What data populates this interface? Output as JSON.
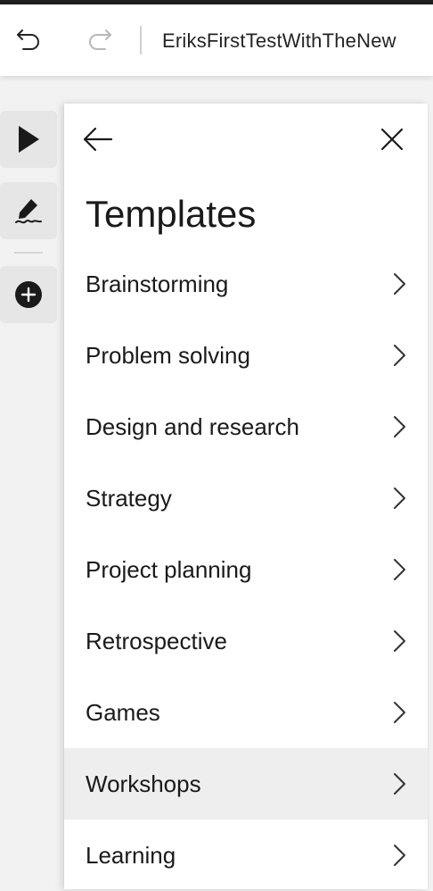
{
  "titlebar": {
    "document_title": "EriksFirstTestWithTheNew",
    "undo_icon": "undo-icon",
    "redo_icon": "redo-icon"
  },
  "toolbar": {
    "tools": [
      "select-pointer-icon",
      "ink-pen-icon",
      "add-circle-icon"
    ]
  },
  "panel": {
    "title": "Templates",
    "back_icon": "arrow-left-icon",
    "close_icon": "close-icon",
    "items": [
      {
        "label": "Brainstorming"
      },
      {
        "label": "Problem solving"
      },
      {
        "label": "Design and research"
      },
      {
        "label": "Strategy"
      },
      {
        "label": "Project planning"
      },
      {
        "label": "Retrospective"
      },
      {
        "label": "Games"
      },
      {
        "label": "Workshops",
        "hovered": true
      },
      {
        "label": "Learning"
      }
    ]
  },
  "colors": {
    "panel_bg": "#ffffff",
    "canvas_bg": "#f2f2f2",
    "tool_bg": "#e6e6e6",
    "hover_bg": "#eeeeee"
  }
}
